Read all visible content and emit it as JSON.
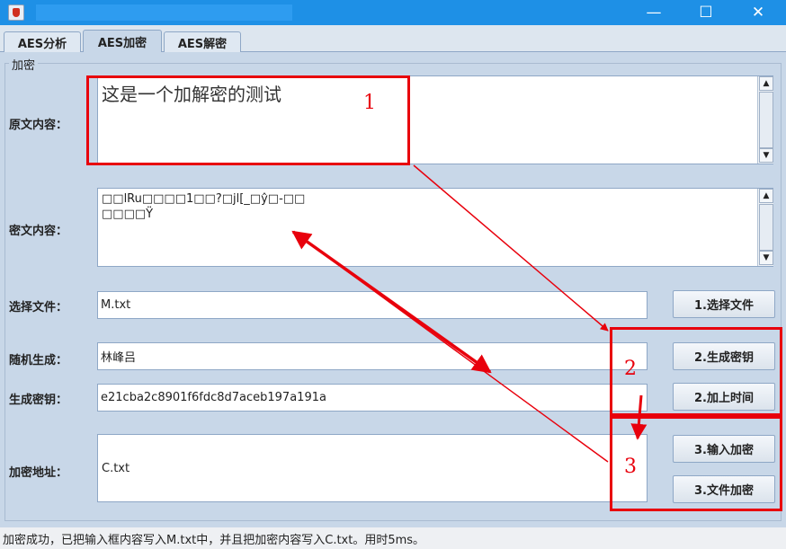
{
  "window": {
    "min_glyph": "—",
    "max_glyph": "☐",
    "close_glyph": "✕"
  },
  "tabs": [
    {
      "label": "AES分析"
    },
    {
      "label": "AES加密"
    },
    {
      "label": "AES解密"
    }
  ],
  "group_title": "加密",
  "plaintext": {
    "label": "原文内容：",
    "value": "这是一个加解密的测试"
  },
  "ciphertext": {
    "label": "密文内容：",
    "line1": "□□lRu□□□□1□□?□jl[_□ŷ□-□□",
    "line2": "□□□□Ÿ"
  },
  "select_file": {
    "label": "选择文件：",
    "value": "M.txt",
    "button": "1.选择文件"
  },
  "random": {
    "label": "随机生成：",
    "value": "林峰吕",
    "button": "2.生成密钥"
  },
  "key": {
    "label": "生成密钥：",
    "value": "e21cba2c8901f6fdc8d7aceb197a191a",
    "button": "2.加上时间"
  },
  "address": {
    "label": "加密地址：",
    "value": "C.txt",
    "button_input": "3.输入加密",
    "button_file": "3.文件加密"
  },
  "annotations": {
    "n1": "1",
    "n2": "2",
    "n3": "3",
    "color": "#e8000c"
  },
  "status": "加密成功，已把输入框内容写入M.txt中，并且把加密内容写入C.txt。用时5ms。"
}
